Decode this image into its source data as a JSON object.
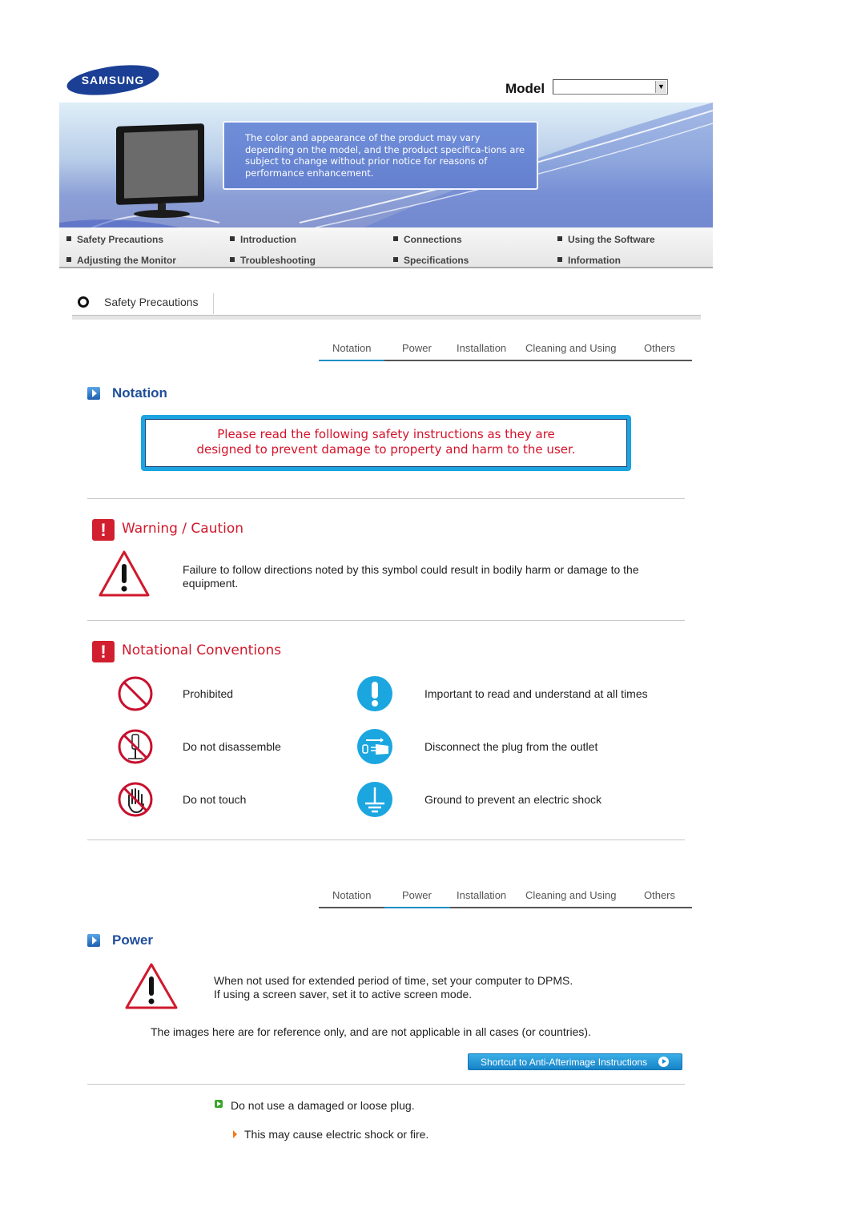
{
  "header": {
    "brand": "SAMSUNG",
    "model_label": "Model",
    "model_value": ""
  },
  "banner": {
    "notice": "The color and appearance of the product may vary depending on the model, and the product specifica-tions are subject to change without prior notice for reasons of performance enhancement."
  },
  "nav": {
    "items": [
      {
        "label": "Safety Precautions"
      },
      {
        "label": "Introduction"
      },
      {
        "label": "Connections"
      },
      {
        "label": "Using the Software"
      },
      {
        "label": "Adjusting the Monitor"
      },
      {
        "label": "Troubleshooting"
      },
      {
        "label": "Specifications"
      },
      {
        "label": "Information"
      }
    ]
  },
  "section": {
    "title": "Safety Precautions"
  },
  "tabs": {
    "items": [
      "Notation",
      "Power",
      "Installation",
      "Cleaning and Using",
      "Others"
    ],
    "accent": "#1a8fc5"
  },
  "notation": {
    "heading": "Notation",
    "notice_line1": "Please read the following safety instructions as they are",
    "notice_line2": "designed to prevent damage to property and harm to the user.",
    "warning_heading": "Warning / Caution",
    "warning_text": "Failure to follow directions noted by this symbol could result in bodily harm or damage to the equipment.",
    "conventions_heading": "Notational Conventions",
    "conventions": [
      {
        "icon": "prohibited-icon",
        "label": "Prohibited"
      },
      {
        "icon": "important-icon",
        "label": "Important to read and understand at all times"
      },
      {
        "icon": "no-disassemble-icon",
        "label": "Do not disassemble"
      },
      {
        "icon": "unplug-icon",
        "label": "Disconnect the plug from the outlet"
      },
      {
        "icon": "no-touch-icon",
        "label": "Do not touch"
      },
      {
        "icon": "ground-icon",
        "label": "Ground to prevent an electric shock"
      }
    ]
  },
  "power": {
    "heading": "Power",
    "dpms_line1": "When not used for extended period of time, set your computer to DPMS.",
    "dpms_line2": "If using a screen saver, set it to active screen mode.",
    "reference_note": "The images here are for reference only, and are not applicable in all cases (or countries).",
    "shortcut_button": "Shortcut to Anti-Afterimage Instructions",
    "item_1": "Do not use a damaged or loose plug.",
    "item_1_detail": "This may cause electric shock or fire."
  },
  "colors": {
    "brand_blue": "#1a3f94",
    "heading_blue": "#1f4e99",
    "warning_red": "#d0192c",
    "info_blue": "#1ca4e0"
  }
}
